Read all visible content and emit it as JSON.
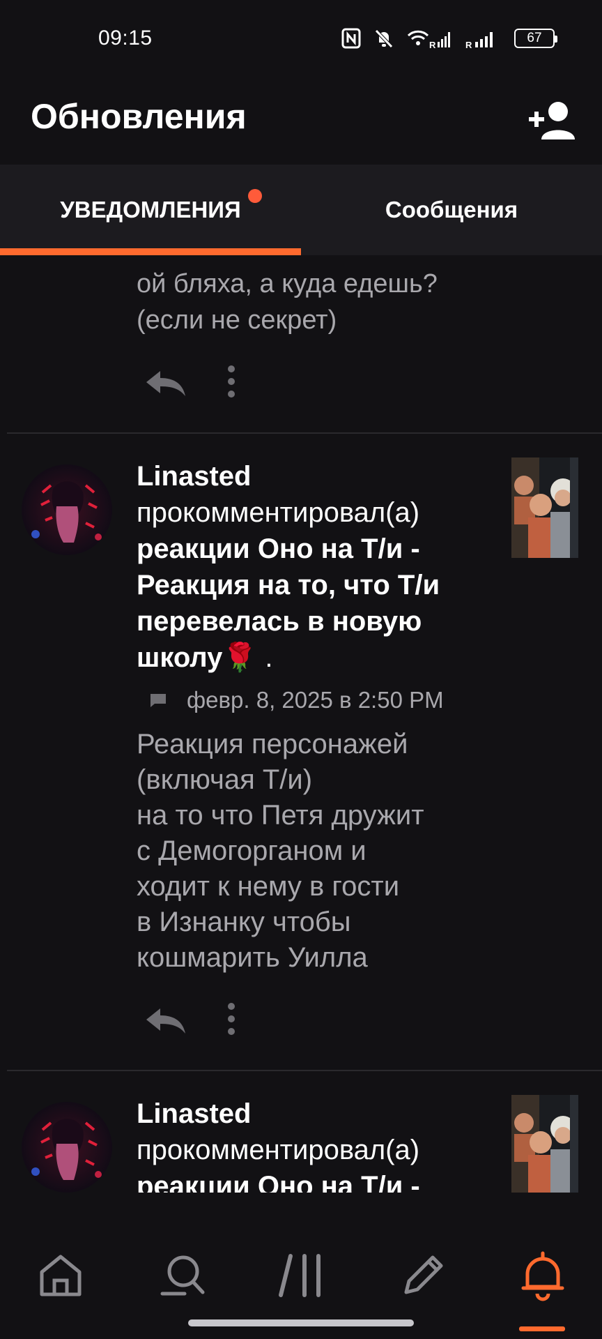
{
  "status_bar": {
    "time": "09:15",
    "battery": "67",
    "icons": [
      "nfc-icon",
      "bell-muted-icon",
      "wifi-icon",
      "signal-icon",
      "signal-icon"
    ]
  },
  "header": {
    "title": "Обновления",
    "action_icon": "add-friend-icon"
  },
  "tabs": [
    {
      "label": "УВЕДОМЛЕНИЯ",
      "active": true,
      "has_badge": true
    },
    {
      "label": "Сообщения",
      "active": false
    }
  ],
  "accent_color": "#ff6a2e",
  "feed": {
    "previous_comment": "ой бляха, а куда едешь?\n(если не секрет)",
    "items": [
      {
        "author": "Linasted",
        "verb": " прокомментировал(а) ",
        "story": "реакции Оно на Т/и - Реакция на то, что Т/и перевелась в новую школу🌹",
        "suffix": " .",
        "date": "февр. 8, 2025 в 2:50 PM",
        "comment": "Реакция персонажей\n(включая Т/и)\nна то что Петя дружит\nс Демогорганом и\nходит к нему в гости\nв Изнанку чтобы\nкошмарить Уилла"
      },
      {
        "author": "Linasted",
        "verb": " прокомментировал(а) ",
        "story": "реакции Оно на Т/и -"
      }
    ]
  },
  "bottom_nav": [
    {
      "icon": "home-icon",
      "active": false
    },
    {
      "icon": "search-icon",
      "active": false
    },
    {
      "icon": "library-icon",
      "active": false
    },
    {
      "icon": "write-icon",
      "active": false
    },
    {
      "icon": "bell-icon",
      "active": true
    }
  ]
}
